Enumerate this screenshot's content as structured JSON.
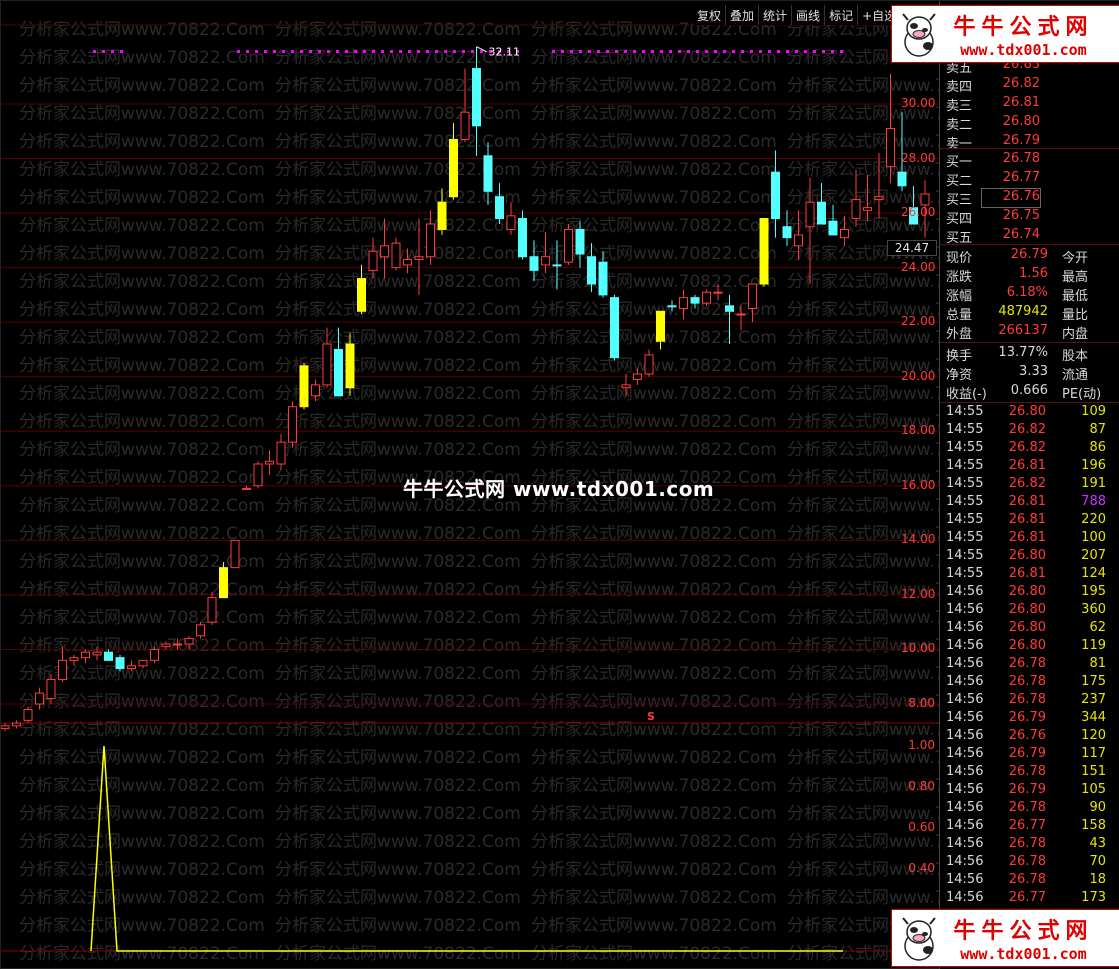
{
  "toolbar": {
    "buttons": [
      "复权",
      "叠加",
      "统计",
      "画线",
      "标记",
      "+自选"
    ]
  },
  "brand": {
    "title": "牛牛公式网",
    "url": "www.tdx001.com",
    "center_text": "牛牛公式网 www.tdx001.com",
    "watermark": "分析家公式网www.70822.Com"
  },
  "chart": {
    "high_label": "32.11",
    "current_price_tag": "24.47",
    "marker": "S",
    "y_axis_main": [
      "30.00",
      "28.00",
      "26.00",
      "24.00",
      "22.00",
      "20.00",
      "18.00",
      "16.00",
      "14.00",
      "12.00",
      "10.00",
      "8.00"
    ],
    "y_axis_sub": [
      "1.00",
      "0.80",
      "0.60",
      "0.40"
    ],
    "colors": {
      "up": "#ff3b3b",
      "down": "#54ffff",
      "signal": "#ffff00",
      "dots": "#ff00ff",
      "grid": "#5a0000"
    }
  },
  "chart_data": {
    "type": "candlestick",
    "ohlc": [
      [
        7.1,
        7.3,
        7.0,
        7.2,
        "up"
      ],
      [
        7.2,
        7.4,
        7.1,
        7.3,
        "up"
      ],
      [
        7.4,
        7.9,
        7.3,
        7.8,
        "up"
      ],
      [
        8.0,
        8.6,
        7.8,
        8.4,
        "up"
      ],
      [
        8.2,
        9.1,
        8.0,
        8.9,
        "up"
      ],
      [
        8.9,
        10.1,
        8.8,
        9.6,
        "up"
      ],
      [
        9.6,
        9.8,
        9.4,
        9.7,
        "up"
      ],
      [
        9.7,
        10.0,
        9.5,
        9.9,
        "up"
      ],
      [
        9.9,
        10.1,
        9.6,
        9.8,
        "up"
      ],
      [
        9.9,
        10.0,
        9.6,
        9.6,
        "down"
      ],
      [
        9.7,
        9.8,
        9.2,
        9.3,
        "down"
      ],
      [
        9.3,
        9.6,
        9.2,
        9.4,
        "up"
      ],
      [
        9.4,
        9.6,
        9.3,
        9.6,
        "up"
      ],
      [
        9.6,
        10.1,
        9.5,
        10.0,
        "up"
      ],
      [
        10.1,
        10.3,
        10.0,
        10.2,
        "up"
      ],
      [
        10.2,
        10.4,
        10.0,
        10.2,
        "up"
      ],
      [
        10.2,
        10.5,
        10.0,
        10.4,
        "up"
      ],
      [
        10.5,
        11.0,
        10.4,
        10.9,
        "up"
      ],
      [
        11.0,
        12.1,
        10.9,
        11.9,
        "up"
      ],
      [
        11.9,
        13.2,
        11.9,
        13.0,
        "signal"
      ],
      [
        13.0,
        14.0,
        13.0,
        14.0,
        "up"
      ],
      [
        15.9,
        16.0,
        15.9,
        15.9,
        "up"
      ],
      [
        16.0,
        16.9,
        15.9,
        16.8,
        "up"
      ],
      [
        16.9,
        17.3,
        16.4,
        16.8,
        "up"
      ],
      [
        16.8,
        17.9,
        16.6,
        17.6,
        "up"
      ],
      [
        17.6,
        19.1,
        17.4,
        18.9,
        "up"
      ],
      [
        18.9,
        20.5,
        18.8,
        20.4,
        "signal"
      ],
      [
        19.3,
        19.9,
        19.1,
        19.7,
        "up"
      ],
      [
        19.7,
        21.8,
        19.6,
        21.2,
        "up"
      ],
      [
        21.0,
        21.8,
        19.3,
        19.3,
        "down"
      ],
      [
        19.6,
        21.6,
        19.3,
        21.2,
        "signal"
      ],
      [
        22.4,
        24.1,
        22.3,
        23.6,
        "signal"
      ],
      [
        23.9,
        25.1,
        23.6,
        24.6,
        "up"
      ],
      [
        24.4,
        25.8,
        23.6,
        24.8,
        "up"
      ],
      [
        24.0,
        25.1,
        23.9,
        24.9,
        "up"
      ],
      [
        24.1,
        24.7,
        23.8,
        24.3,
        "up"
      ],
      [
        24.3,
        25.8,
        23.0,
        24.4,
        "up"
      ],
      [
        24.4,
        26.1,
        24.1,
        25.6,
        "up"
      ],
      [
        25.4,
        26.9,
        25.2,
        26.4,
        "signal"
      ],
      [
        26.6,
        29.3,
        26.5,
        28.7,
        "signal"
      ],
      [
        28.7,
        31.3,
        28.6,
        29.7,
        "up"
      ],
      [
        29.2,
        32.1,
        28.1,
        31.3,
        "down"
      ],
      [
        28.1,
        28.6,
        26.3,
        26.8,
        "down"
      ],
      [
        26.6,
        27.1,
        25.6,
        25.8,
        "down"
      ],
      [
        25.9,
        26.4,
        25.2,
        25.4,
        "up"
      ],
      [
        25.8,
        26.1,
        24.3,
        24.4,
        "down"
      ],
      [
        24.4,
        25.0,
        23.5,
        23.9,
        "down"
      ],
      [
        24.1,
        25.3,
        23.8,
        24.4,
        "up"
      ],
      [
        24.1,
        25.0,
        23.2,
        24.1,
        "down"
      ],
      [
        24.2,
        25.6,
        24.1,
        25.4,
        "up"
      ],
      [
        25.4,
        25.7,
        24.0,
        24.5,
        "down"
      ],
      [
        24.4,
        24.9,
        23.1,
        23.4,
        "down"
      ],
      [
        24.2,
        24.6,
        22.9,
        23.0,
        "down"
      ],
      [
        22.9,
        23.0,
        20.6,
        20.7,
        "down"
      ],
      [
        19.6,
        20.1,
        19.3,
        19.7,
        "up"
      ],
      [
        19.9,
        20.3,
        19.7,
        20.1,
        "up"
      ],
      [
        20.1,
        21.0,
        20.0,
        20.8,
        "up"
      ],
      [
        21.3,
        22.4,
        21.0,
        22.4,
        "signal"
      ],
      [
        22.6,
        22.8,
        22.4,
        22.6,
        "down"
      ],
      [
        22.5,
        23.2,
        22.1,
        22.9,
        "up"
      ],
      [
        22.9,
        23.0,
        22.5,
        22.7,
        "down"
      ],
      [
        22.7,
        23.2,
        22.6,
        23.1,
        "up"
      ],
      [
        23.1,
        23.4,
        22.8,
        23.1,
        "up"
      ],
      [
        22.6,
        23.0,
        21.2,
        22.4,
        "down"
      ],
      [
        22.3,
        22.6,
        21.7,
        22.3,
        "up"
      ],
      [
        22.5,
        23.1,
        22.0,
        23.4,
        "up"
      ],
      [
        23.4,
        25.8,
        23.3,
        25.8,
        "signal"
      ],
      [
        25.8,
        28.3,
        25.1,
        27.5,
        "down"
      ],
      [
        25.5,
        26.1,
        24.8,
        25.1,
        "down"
      ],
      [
        24.8,
        26.1,
        24.3,
        25.2,
        "up"
      ],
      [
        25.5,
        27.3,
        23.4,
        26.4,
        "up"
      ],
      [
        26.4,
        27.1,
        25.8,
        25.6,
        "down"
      ],
      [
        25.7,
        26.3,
        25.3,
        25.2,
        "down"
      ],
      [
        25.1,
        25.9,
        24.8,
        25.4,
        "up"
      ],
      [
        25.8,
        27.6,
        25.5,
        26.5,
        "up"
      ],
      [
        26.2,
        27.4,
        25.7,
        26.1,
        "up"
      ],
      [
        26.5,
        28.2,
        25.8,
        26.6,
        "up"
      ],
      [
        27.7,
        31.1,
        27.1,
        29.1,
        "up"
      ],
      [
        27.5,
        29.7,
        26.8,
        27.0,
        "down"
      ],
      [
        26.2,
        27.0,
        25.6,
        25.6,
        "down"
      ],
      [
        26.3,
        27.2,
        25.1,
        26.7,
        "up"
      ]
    ],
    "indicator": [
      0,
      0,
      0,
      0,
      0,
      0,
      1,
      0,
      0,
      0,
      0,
      0,
      0,
      0,
      0,
      0,
      0,
      0,
      0,
      0,
      0,
      0,
      0,
      0,
      0,
      0,
      0,
      0,
      0,
      0,
      0,
      0,
      0,
      0,
      0,
      0,
      0,
      0,
      0,
      0,
      0,
      0,
      0,
      0,
      0,
      0,
      0,
      0,
      0,
      0,
      0,
      0,
      0,
      0,
      0,
      0,
      0,
      0,
      0,
      0,
      0,
      0,
      0,
      0,
      0,
      0,
      0,
      0,
      0,
      0,
      0,
      0,
      0,
      0,
      0,
      0,
      0,
      0,
      0,
      0,
      0
    ],
    "ylim_main": [
      8.0,
      30.0
    ],
    "ylim_sub": [
      0.4,
      1.0
    ]
  },
  "orderbook": {
    "asks": [
      {
        "label": "卖五",
        "price": "26.83"
      },
      {
        "label": "卖四",
        "price": "26.82"
      },
      {
        "label": "卖三",
        "price": "26.81"
      },
      {
        "label": "卖二",
        "price": "26.80"
      },
      {
        "label": "卖一",
        "price": "26.79"
      }
    ],
    "bids": [
      {
        "label": "买一",
        "price": "26.78"
      },
      {
        "label": "买二",
        "price": "26.77"
      },
      {
        "label": "买三",
        "price": "26.76"
      },
      {
        "label": "买四",
        "price": "26.75"
      },
      {
        "label": "买五",
        "price": "26.74"
      }
    ]
  },
  "quote": {
    "rows": [
      {
        "l1": "现价",
        "v1": "26.79",
        "c1": "#ff3b3b",
        "l2": "今开"
      },
      {
        "l1": "涨跌",
        "v1": "1.56",
        "c1": "#ff3b3b",
        "l2": "最高"
      },
      {
        "l1": "涨幅",
        "v1": "6.18%",
        "c1": "#ff3b3b",
        "l2": "最低"
      },
      {
        "l1": "总量",
        "v1": "487942",
        "c1": "#e6e600",
        "l2": "量比"
      },
      {
        "l1": "外盘",
        "v1": "266137",
        "c1": "#ff3b3b",
        "l2": "内盘"
      }
    ],
    "rows2": [
      {
        "l1": "换手",
        "v1": "13.77%",
        "c1": "#d8d8d8",
        "l2": "股本"
      },
      {
        "l1": "净资",
        "v1": "3.33",
        "c1": "#d8d8d8",
        "l2": "流通"
      },
      {
        "l1": "收益(-)",
        "v1": "0.666",
        "c1": "#d8d8d8",
        "l2": "PE(动)"
      }
    ]
  },
  "ticks": [
    {
      "time": "14:55",
      "price": "26.80",
      "vol": "109",
      "vc": "#e6e600"
    },
    {
      "time": "14:55",
      "price": "26.82",
      "vol": "87",
      "vc": "#e6e600"
    },
    {
      "time": "14:55",
      "price": "26.82",
      "vol": "86",
      "vc": "#e6e600"
    },
    {
      "time": "14:55",
      "price": "26.81",
      "vol": "196",
      "vc": "#e6e600"
    },
    {
      "time": "14:55",
      "price": "26.82",
      "vol": "191",
      "vc": "#e6e600"
    },
    {
      "time": "14:55",
      "price": "26.81",
      "vol": "788",
      "vc": "#cc33ff"
    },
    {
      "time": "14:55",
      "price": "26.81",
      "vol": "220",
      "vc": "#e6e600"
    },
    {
      "time": "14:55",
      "price": "26.81",
      "vol": "100",
      "vc": "#e6e600"
    },
    {
      "time": "14:55",
      "price": "26.80",
      "vol": "207",
      "vc": "#e6e600"
    },
    {
      "time": "14:55",
      "price": "26.81",
      "vol": "124",
      "vc": "#e6e600"
    },
    {
      "time": "14:56",
      "price": "26.80",
      "vol": "195",
      "vc": "#e6e600"
    },
    {
      "time": "14:56",
      "price": "26.80",
      "vol": "360",
      "vc": "#e6e600"
    },
    {
      "time": "14:56",
      "price": "26.80",
      "vol": "62",
      "vc": "#e6e600"
    },
    {
      "time": "14:56",
      "price": "26.80",
      "vol": "119",
      "vc": "#e6e600"
    },
    {
      "time": "14:56",
      "price": "26.78",
      "vol": "81",
      "vc": "#e6e600"
    },
    {
      "time": "14:56",
      "price": "26.78",
      "vol": "175",
      "vc": "#e6e600"
    },
    {
      "time": "14:56",
      "price": "26.78",
      "vol": "237",
      "vc": "#e6e600"
    },
    {
      "time": "14:56",
      "price": "26.79",
      "vol": "344",
      "vc": "#e6e600"
    },
    {
      "time": "14:56",
      "price": "26.76",
      "vol": "120",
      "vc": "#e6e600"
    },
    {
      "time": "14:56",
      "price": "26.79",
      "vol": "117",
      "vc": "#e6e600"
    },
    {
      "time": "14:56",
      "price": "26.78",
      "vol": "151",
      "vc": "#e6e600"
    },
    {
      "time": "14:56",
      "price": "26.79",
      "vol": "105",
      "vc": "#e6e600"
    },
    {
      "time": "14:56",
      "price": "26.78",
      "vol": "90",
      "vc": "#e6e600"
    },
    {
      "time": "14:56",
      "price": "26.77",
      "vol": "158",
      "vc": "#e6e600"
    },
    {
      "time": "14:56",
      "price": "26.78",
      "vol": "43",
      "vc": "#e6e600"
    },
    {
      "time": "14:56",
      "price": "26.78",
      "vol": "70",
      "vc": "#e6e600"
    },
    {
      "time": "14:56",
      "price": "26.78",
      "vol": "18",
      "vc": "#e6e600"
    },
    {
      "time": "14:56",
      "price": "26.77",
      "vol": "173",
      "vc": "#e6e600"
    }
  ]
}
